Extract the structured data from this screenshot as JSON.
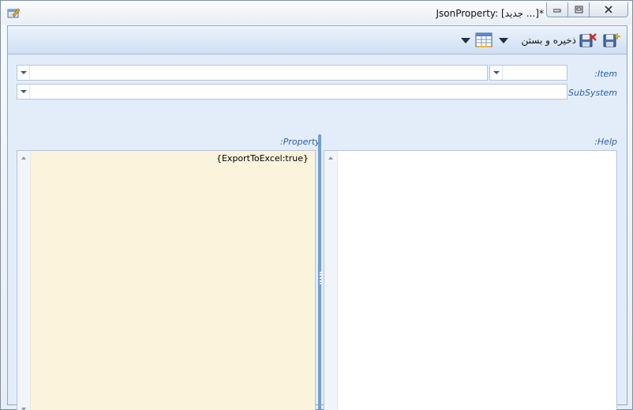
{
  "window": {
    "title": "JsonProperty: [جدید ...]*",
    "icons": {
      "app": "edit-window-icon",
      "minimize": "minimize-icon",
      "maximize": "restore-icon",
      "close": "close-icon"
    }
  },
  "toolbar": {
    "save_and_close_label": "ذخیره و بستن",
    "icons": [
      "save-new-icon",
      "save-close-icon",
      "dropdown-arrow-icon",
      "table-icon",
      "dropdown-arrow-icon"
    ]
  },
  "form": {
    "item_label": ":Item",
    "subsystem_label": ":SubSystem",
    "property_label": ":Property",
    "help_label": ":Help",
    "item_code_value": "",
    "item_value": "",
    "subsystem_value": "",
    "property_value": "{ExportToExcel:true}",
    "help_value": ""
  },
  "colors": {
    "label_blue": "#2a5fa8",
    "property_bg": "#fbf3dc",
    "splitter": "#6f9fd8"
  }
}
